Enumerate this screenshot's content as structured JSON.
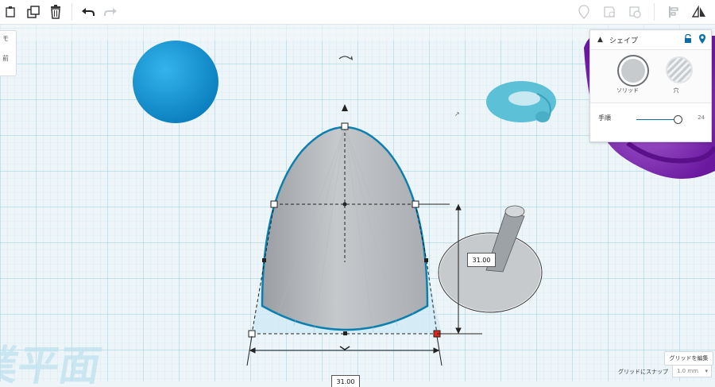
{
  "toolbar": {
    "left_tools": [
      "paste-icon",
      "duplicate-icon",
      "delete-icon",
      "undo-icon",
      "redo-icon"
    ],
    "right_tools": [
      "note-icon",
      "comment-icon",
      "visibility-icon",
      "align-icon",
      "mirror-icon"
    ]
  },
  "left_panel": {
    "line1": "モ",
    "line2": "前"
  },
  "inspector": {
    "title": "シェイプ",
    "solid_label": "ソリッド",
    "hole_label": "穴",
    "steps_label": "手順",
    "steps_value": "24",
    "steps_fraction": 0.94
  },
  "dimensions": {
    "height_value": "31.00",
    "width_value": "31.00"
  },
  "bottom": {
    "edit_grid_label": "グリッドを編集",
    "snap_label": "グリッドにスナップ",
    "snap_value": "1.0 mm"
  },
  "watermark_text": "作業平面",
  "colors": {
    "accent": "#0b6fa6",
    "grid_fine": "#bfe3ef",
    "grid_major": "#8cc9de",
    "sphere": "#1c99d6",
    "torus": "#58bcd2",
    "purple": "#7a24b0",
    "selection_handle": "#e0261b"
  }
}
